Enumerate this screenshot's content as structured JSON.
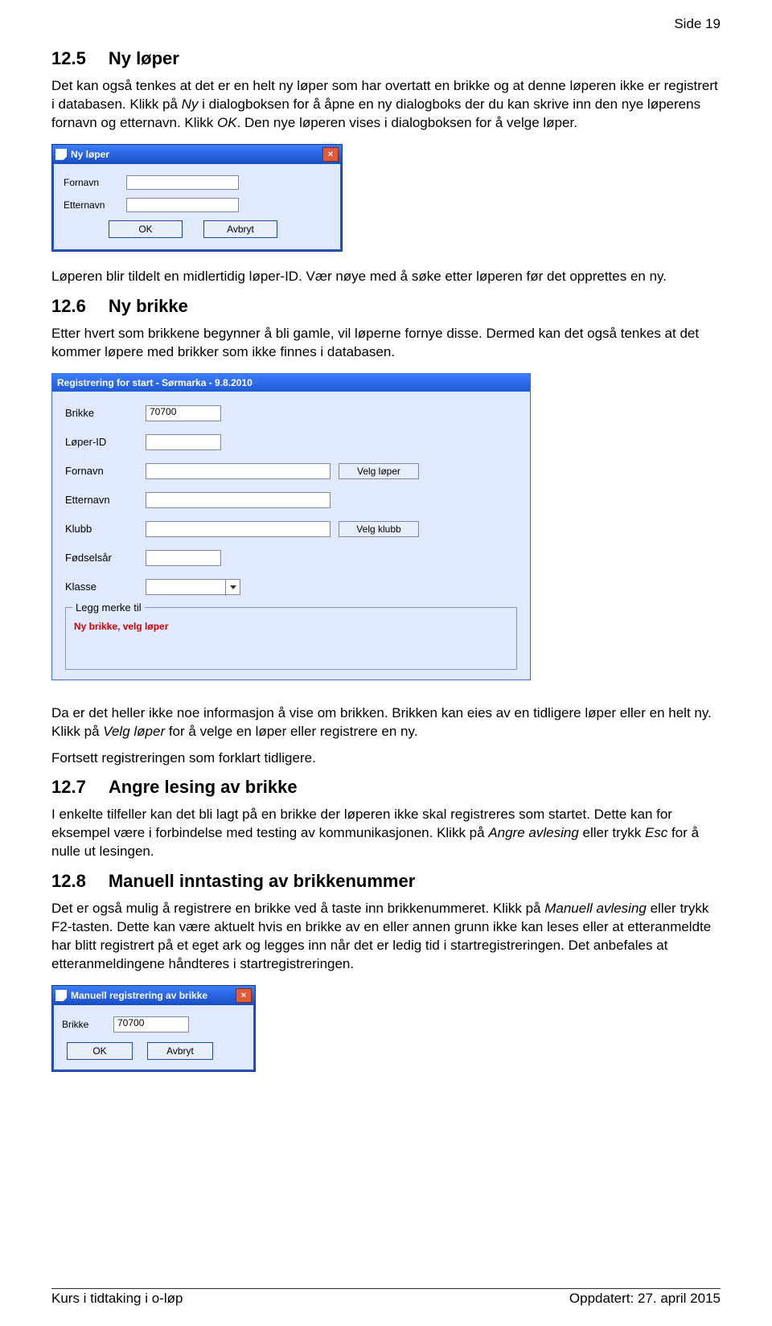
{
  "page_number": "Side 19",
  "sec125": {
    "num": "12.5",
    "title": "Ny løper",
    "p1": "Det kan også tenkes at det er en helt ny løper som har overtatt en brikke og at denne løperen ikke er registrert i databasen. Klikk på ",
    "p1_em1": "Ny",
    "p1_mid": " i dialogboksen for å åpne en ny dialogboks der du kan skrive inn den nye løperens fornavn og etternavn. Klikk ",
    "p1_em2": "OK",
    "p1_end": ". Den nye løperen vises i dialogboksen for å velge løper.",
    "p2": "Løperen blir tildelt en midlertidig løper-ID. Vær nøye med å søke etter løperen før det opprettes en ny."
  },
  "dlg1": {
    "title": "Ny løper",
    "fornavn": "Fornavn",
    "etternavn": "Etternavn",
    "ok": "OK",
    "avbryt": "Avbryt"
  },
  "sec126": {
    "num": "12.6",
    "title": "Ny brikke",
    "p1": "Etter hvert som brikkene begynner å bli gamle, vil løperne fornye disse. Dermed kan det også tenkes at det kommer løpere med brikker som ikke finnes i databasen.",
    "p2_a": "Da er det heller ikke noe informasjon å vise om brikken. Brikken kan eies av en tidligere løper eller en helt ny. Klikk på ",
    "p2_em": "Velg løper",
    "p2_b": " for å velge en løper eller registrere en ny.",
    "p3": "Fortsett registreringen som forklart tidligere."
  },
  "dlg2": {
    "title": "Registrering for start - Sørmarka - 9.8.2010",
    "brikke": "Brikke",
    "brikke_val": "70700",
    "loper_id": "Løper-ID",
    "fornavn": "Fornavn",
    "etternavn": "Etternavn",
    "klubb": "Klubb",
    "fodselsar": "Fødselsår",
    "klasse": "Klasse",
    "velg_loper": "Velg løper",
    "velg_klubb": "Velg klubb",
    "group_legend": "Legg merke til",
    "group_msg": "Ny brikke, velg løper"
  },
  "sec127": {
    "num": "12.7",
    "title": "Angre lesing av brikke",
    "p1_a": "I enkelte tilfeller kan det bli lagt på en brikke der løperen ikke skal registreres som startet. Dette kan for eksempel være i forbindelse med testing av kommunikasjonen. Klikk på ",
    "p1_em1": "Angre avlesing",
    "p1_b": " eller trykk ",
    "p1_em2": "Esc",
    "p1_c": " for å nulle ut lesingen."
  },
  "sec128": {
    "num": "12.8",
    "title": "Manuell inntasting av brikkenummer",
    "p1_a": "Det er også mulig å registrere en brikke ved å taste inn brikkenummeret. Klikk på ",
    "p1_em": "Manuell avlesing",
    "p1_b": " eller trykk F2-tasten. Dette kan være aktuelt hvis en brikke av en eller annen grunn ikke kan leses eller at etteranmeldte har blitt registrert på et eget ark og legges inn når det er ledig tid i startregistreringen. Det anbefales at etteranmeldingene håndteres i startregistreringen."
  },
  "dlg3": {
    "title": "Manuell registrering av brikke",
    "brikke": "Brikke",
    "brikke_val": "70700",
    "ok": "OK",
    "avbryt": "Avbryt"
  },
  "footer": {
    "left": "Kurs i tidtaking i o-løp",
    "right": "Oppdatert: 27. april 2015"
  }
}
